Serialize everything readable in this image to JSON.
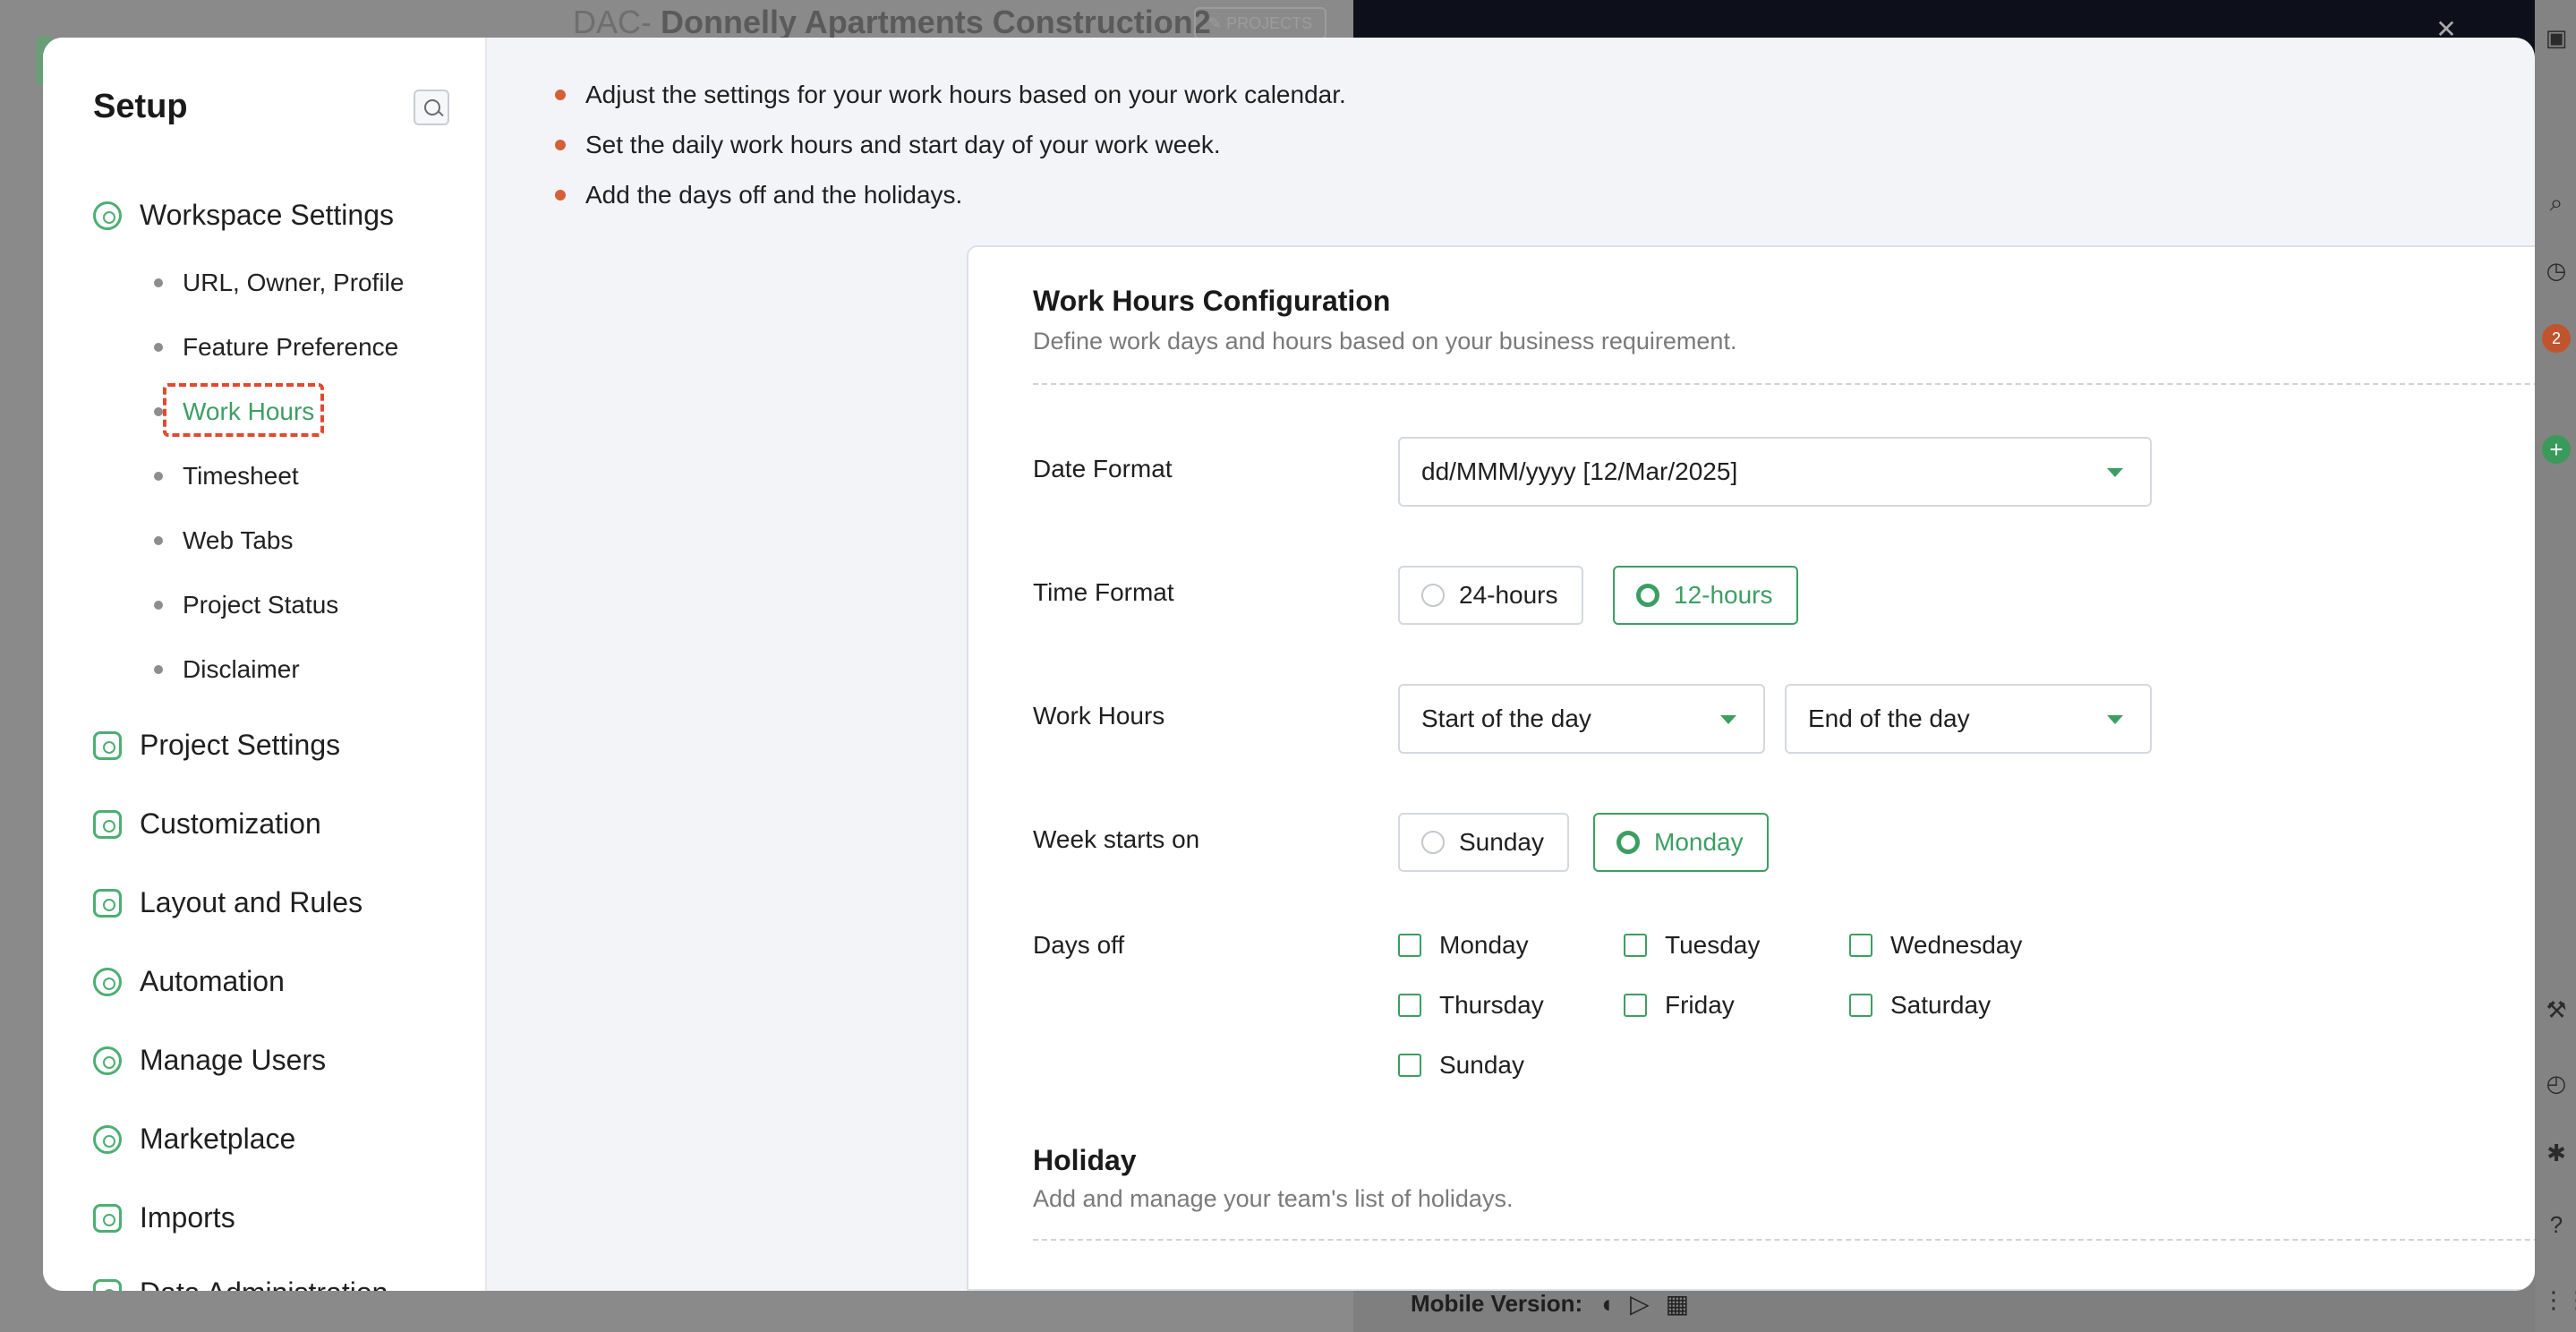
{
  "background": {
    "project_prefix": "DAC-",
    "project_name": "Donnelly Apartments Construction2",
    "projects_chip": "✎ PROJECTS",
    "rail_badge": "2",
    "mobile_label": "Mobile Version:"
  },
  "sidebar": {
    "title": "Setup",
    "sections": [
      {
        "label": "Workspace Settings",
        "icon": "workspace-icon"
      },
      {
        "label": "Project Settings",
        "icon": "project-icon"
      },
      {
        "label": "Customization",
        "icon": "customization-icon"
      },
      {
        "label": "Layout and Rules",
        "icon": "layout-icon"
      },
      {
        "label": "Automation",
        "icon": "automation-icon"
      },
      {
        "label": "Manage Users",
        "icon": "users-icon"
      },
      {
        "label": "Marketplace",
        "icon": "marketplace-icon"
      },
      {
        "label": "Imports",
        "icon": "imports-icon"
      },
      {
        "label": "Data Administration",
        "icon": "data-icon"
      }
    ],
    "workspace_items": [
      "URL, Owner, Profile",
      "Feature Preference",
      "Work Hours",
      "Timesheet",
      "Web Tabs",
      "Project Status",
      "Disclaimer"
    ]
  },
  "info_bullets": [
    "Adjust the settings for your work hours based on your work calendar.",
    "Set the daily work hours and start day of your work week.",
    "Add the days off and the holidays."
  ],
  "work_hours": {
    "title": "Work Hours Configuration",
    "description": "Define work days and hours based on your business requirement.",
    "date_format_label": "Date Format",
    "date_format_value": "dd/MMM/yyyy [12/Mar/2025]",
    "time_format_label": "Time Format",
    "time_format_options": [
      "24-hours",
      "12-hours"
    ],
    "time_format_selected": "12-hours",
    "work_hours_label": "Work Hours",
    "start_placeholder": "Start of the day",
    "end_placeholder": "End of the day",
    "week_start_label": "Week starts on",
    "week_start_options": [
      "Sunday",
      "Monday"
    ],
    "week_start_selected": "Monday",
    "days_off_label": "Days off",
    "days": [
      "Monday",
      "Tuesday",
      "Wednesday",
      "Thursday",
      "Friday",
      "Saturday",
      "Sunday"
    ]
  },
  "holiday": {
    "title": "Holiday",
    "description": "Add and manage your team's list of holidays."
  },
  "colors": {
    "accent": "#3d9e63",
    "highlight": "#e04a2f",
    "bullet": "#d4603a"
  }
}
